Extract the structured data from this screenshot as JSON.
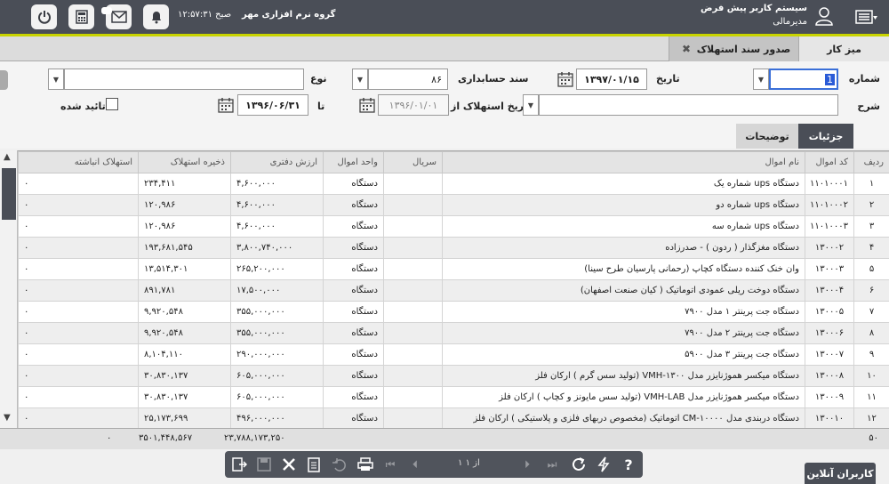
{
  "header": {
    "company": "گروه نرم افزاری مهر",
    "time": "۱۲:۵۷:۳۱ صبح",
    "user_name": "سیستم کاربر پیش فرض",
    "user_role": "مدیرمالی"
  },
  "tabs": [
    {
      "label": "میز کار"
    },
    {
      "label": "صدور سند استهلاک"
    }
  ],
  "form": {
    "number_label": "شماره",
    "number_value": "1",
    "date_label": "تاریخ",
    "date_value": "۱۳۹۷/۰۱/۱۵",
    "voucher_label": "سند حسابداری",
    "voucher_value": "۸۶",
    "type_label": "نوع",
    "type_value": "",
    "desc_label": "شرح",
    "depr_date_from_label": "تاریخ استهلاک از",
    "depr_date_from_value": "۱۳۹۶/۰۱/۰۱",
    "to_label": "تا",
    "to_value": "۱۳۹۶/۰۶/۳۱",
    "approved_label": "تائید شده"
  },
  "detail_tabs": [
    {
      "label": "جزئیات"
    },
    {
      "label": "توضیحات"
    }
  ],
  "columns": [
    "ردیف",
    "کد اموال",
    "نام اموال",
    "سریال",
    "واحد اموال",
    "ارزش دفتری",
    "ذخیره استهلاک",
    "استهلاک انباشته"
  ],
  "rows": [
    {
      "row": "۱",
      "code": "۱۱۰۱۰۰۰۱",
      "name": "دستگاه ups شماره یک",
      "serial": "",
      "unit": "دستگاه",
      "book": "۴,۶۰۰,۰۰۰",
      "reserve": "۲۳۴,۴۱۱",
      "accum": "۰"
    },
    {
      "row": "۲",
      "code": "۱۱۰۱۰۰۰۲",
      "name": "دستگاه ups شماره دو",
      "serial": "",
      "unit": "دستگاه",
      "book": "۴,۶۰۰,۰۰۰",
      "reserve": "۱۲۰,۹۸۶",
      "accum": "۰"
    },
    {
      "row": "۳",
      "code": "۱۱۰۱۰۰۰۳",
      "name": "دستگاه ups شماره سه",
      "serial": "",
      "unit": "دستگاه",
      "book": "۴,۶۰۰,۰۰۰",
      "reserve": "۱۲۰,۹۸۶",
      "accum": "۰"
    },
    {
      "row": "۴",
      "code": "۱۳۰۰۰۲",
      "name": "دستگاه مغزگذار ( ردون ) - صدرزاده",
      "serial": "",
      "unit": "دستگاه",
      "book": "۳,۸۰۰,۷۴۰,۰۰۰",
      "reserve": "۱۹۳,۶۸۱,۵۴۵",
      "accum": "۰"
    },
    {
      "row": "۵",
      "code": "۱۳۰۰۰۳",
      "name": "وان خنک کننده دستگاه کچاپ (رحمانی پارسیان طرح سینا)",
      "serial": "",
      "unit": "دستگاه",
      "book": "۲۶۵,۲۰۰,۰۰۰",
      "reserve": "۱۳,۵۱۴,۳۰۱",
      "accum": "۰"
    },
    {
      "row": "۶",
      "code": "۱۳۰۰۰۴",
      "name": "دستگاه دوخت ریلی عمودی اتوماتیک ( کیان صنعت اصفهان)",
      "serial": "",
      "unit": "دستگاه",
      "book": "۱۷,۵۰۰,۰۰۰",
      "reserve": "۸۹۱,۷۸۱",
      "accum": "۰"
    },
    {
      "row": "۷",
      "code": "۱۳۰۰۰۵",
      "name": "دستگاه جت پرینتر ۱ مدل ۷۹۰۰",
      "serial": "",
      "unit": "دستگاه",
      "book": "۳۵۵,۰۰۰,۰۰۰",
      "reserve": "۹,۹۲۰,۵۴۸",
      "accum": "۰"
    },
    {
      "row": "۸",
      "code": "۱۳۰۰۰۶",
      "name": "دستگاه جت پرینتر ۲ مدل ۷۹۰۰",
      "serial": "",
      "unit": "دستگاه",
      "book": "۳۵۵,۰۰۰,۰۰۰",
      "reserve": "۹,۹۲۰,۵۴۸",
      "accum": "۰"
    },
    {
      "row": "۹",
      "code": "۱۳۰۰۰۷",
      "name": "دستگاه جت پرینتر ۳ مدل ۵۹۰۰",
      "serial": "",
      "unit": "دستگاه",
      "book": "۲۹۰,۰۰۰,۰۰۰",
      "reserve": "۸,۱۰۴,۱۱۰",
      "accum": "۰"
    },
    {
      "row": "۱۰",
      "code": "۱۳۰۰۰۸",
      "name": "دستگاه میکسر هموژنایزر مدل VMH-۱۳۰۰ (تولید سس گرم ) ارکان فلز",
      "serial": "",
      "unit": "دستگاه",
      "book": "۶۰۵,۰۰۰,۰۰۰",
      "reserve": "۳۰,۸۳۰,۱۳۷",
      "accum": "۰"
    },
    {
      "row": "۱۱",
      "code": "۱۳۰۰۰۹",
      "name": "دستگاه میکسر هموژنایزر مدل VMH-LAB (تولید سس مایونز و کچاپ ) ارکان فلز",
      "serial": "",
      "unit": "دستگاه",
      "book": "۶۰۵,۰۰۰,۰۰۰",
      "reserve": "۳۰,۸۳۰,۱۳۷",
      "accum": "۰"
    },
    {
      "row": "۱۲",
      "code": "۱۳۰۰۱۰",
      "name": "دستگاه دربندی مدل CM-۱۰۰۰۰ اتوماتیک (مخصوص دربهای فلزی و پلاستیکی ) ارکان فلز",
      "serial": "",
      "unit": "دستگاه",
      "book": "۴۹۶,۰۰۰,۰۰۰",
      "reserve": "۲۵,۱۷۳,۶۹۹",
      "accum": "۰"
    }
  ],
  "footer": {
    "count": "۵۰",
    "book_total": "۲۳,۷۸۸,۱۷۳,۲۵۰",
    "reserve_total": "۳۵۰۱,۴۴۸,۵۶۷",
    "accum_total": "۰"
  },
  "toolbar": {
    "page_info": "۱ از ۱"
  },
  "online_users": "کاربران آنلاین"
}
